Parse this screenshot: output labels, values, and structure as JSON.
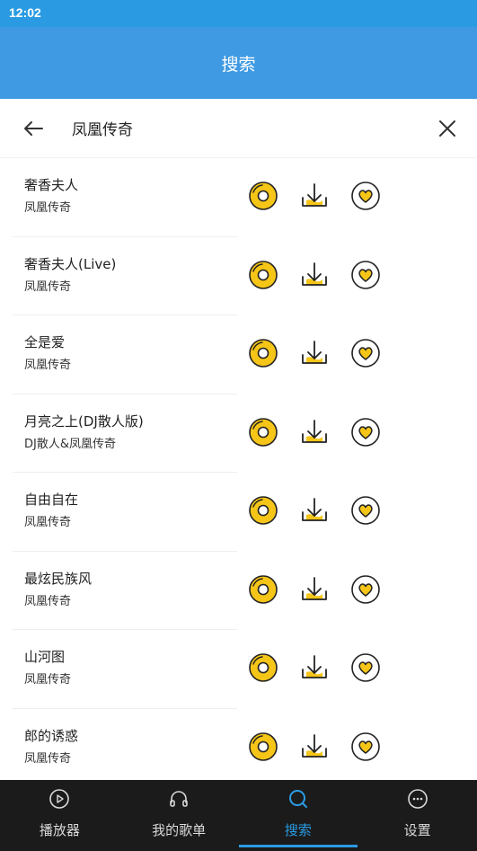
{
  "status_bar": {
    "time": "12:02"
  },
  "app_bar": {
    "title": "搜索"
  },
  "search": {
    "query": "凤凰传奇"
  },
  "songs": [
    {
      "title": "奢香夫人",
      "artist": "凤凰传奇"
    },
    {
      "title": "奢香夫人(Live)",
      "artist": "凤凰传奇"
    },
    {
      "title": "全是爱",
      "artist": "凤凰传奇"
    },
    {
      "title": "月亮之上(DJ散人版)",
      "artist": "DJ散人&凤凰传奇"
    },
    {
      "title": "自由自在",
      "artist": "凤凰传奇"
    },
    {
      "title": "最炫民族风",
      "artist": "凤凰传奇"
    },
    {
      "title": "山河图",
      "artist": "凤凰传奇"
    },
    {
      "title": "郎的诱惑",
      "artist": "凤凰传奇"
    }
  ],
  "row_actions": [
    "play-disc-icon",
    "download-icon",
    "heart-favorite-icon"
  ],
  "nav": [
    {
      "label": "播放器",
      "icon": "play-circle-icon",
      "active": false
    },
    {
      "label": "我的歌单",
      "icon": "headphones-icon",
      "active": false
    },
    {
      "label": "搜索",
      "icon": "search-icon",
      "active": true
    },
    {
      "label": "设置",
      "icon": "more-circle-icon",
      "active": false
    }
  ],
  "colors": {
    "status_bar": "#2a9be2",
    "app_bar": "#3f9ae3",
    "accent_yellow": "#f5c518",
    "nav_background": "#1b1b1b",
    "nav_active": "#2a9be2"
  }
}
